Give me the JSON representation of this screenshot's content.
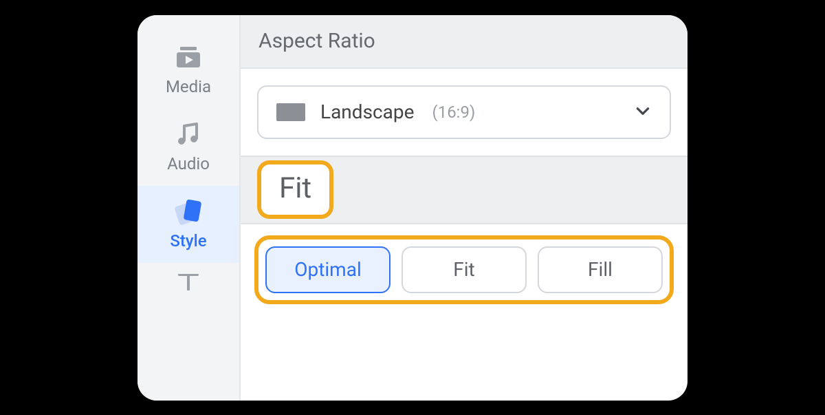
{
  "sidebar": {
    "items": [
      {
        "label": "Media",
        "icon": "media-icon"
      },
      {
        "label": "Audio",
        "icon": "music-icon"
      },
      {
        "label": "Style",
        "icon": "style-icon"
      },
      {
        "label": "Text",
        "icon": "text-icon"
      }
    ],
    "active_index": 2
  },
  "sections": {
    "aspect_ratio": {
      "title": "Aspect Ratio",
      "selected_label": "Landscape",
      "selected_sub": "(16:9)"
    },
    "fit": {
      "title": "Fit",
      "options": [
        "Optimal",
        "Fit",
        "Fill"
      ],
      "selected_index": 0
    }
  }
}
